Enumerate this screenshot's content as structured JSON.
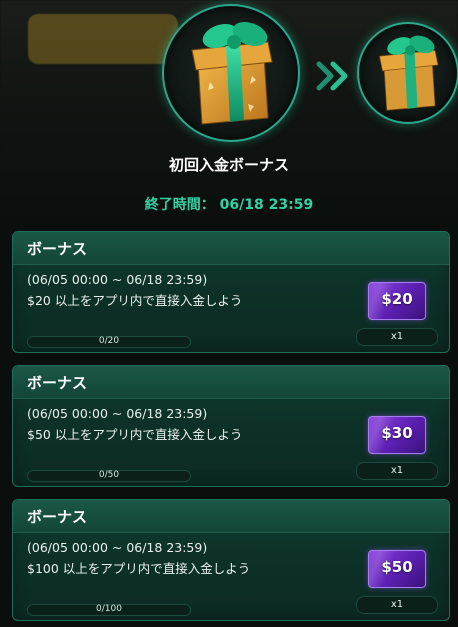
{
  "header": {
    "title": "初回入金ボーナス",
    "end_time_label": "終了時間：",
    "end_time_value": "06/18 23:59"
  },
  "icons": {
    "current_gift": "gift-box-icon",
    "next_gift": "gift-box-icon",
    "arrow": "double-chevron-right-icon"
  },
  "colors": {
    "accent": "#35d0a4",
    "card_bg": "#0d3128",
    "voucher": "#6b2bd0"
  },
  "cards": [
    {
      "title": "ボーナス",
      "period": "(06/05 00:00 ~ 06/18 23:59)",
      "description": "$20 以上をアプリ内で直接入金しよう",
      "progress_text": "0/20",
      "progress": 0,
      "reward": "$20",
      "quantity": "x1"
    },
    {
      "title": "ボーナス",
      "period": "(06/05 00:00 ~ 06/18 23:59)",
      "description": "$50 以上をアプリ内で直接入金しよう",
      "progress_text": "0/50",
      "progress": 0,
      "reward": "$30",
      "quantity": "x1"
    },
    {
      "title": "ボーナス",
      "period": "(06/05 00:00 ~ 06/18 23:59)",
      "description": "$100 以上をアプリ内で直接入金しよう",
      "progress_text": "0/100",
      "progress": 0,
      "reward": "$50",
      "quantity": "x1"
    }
  ]
}
